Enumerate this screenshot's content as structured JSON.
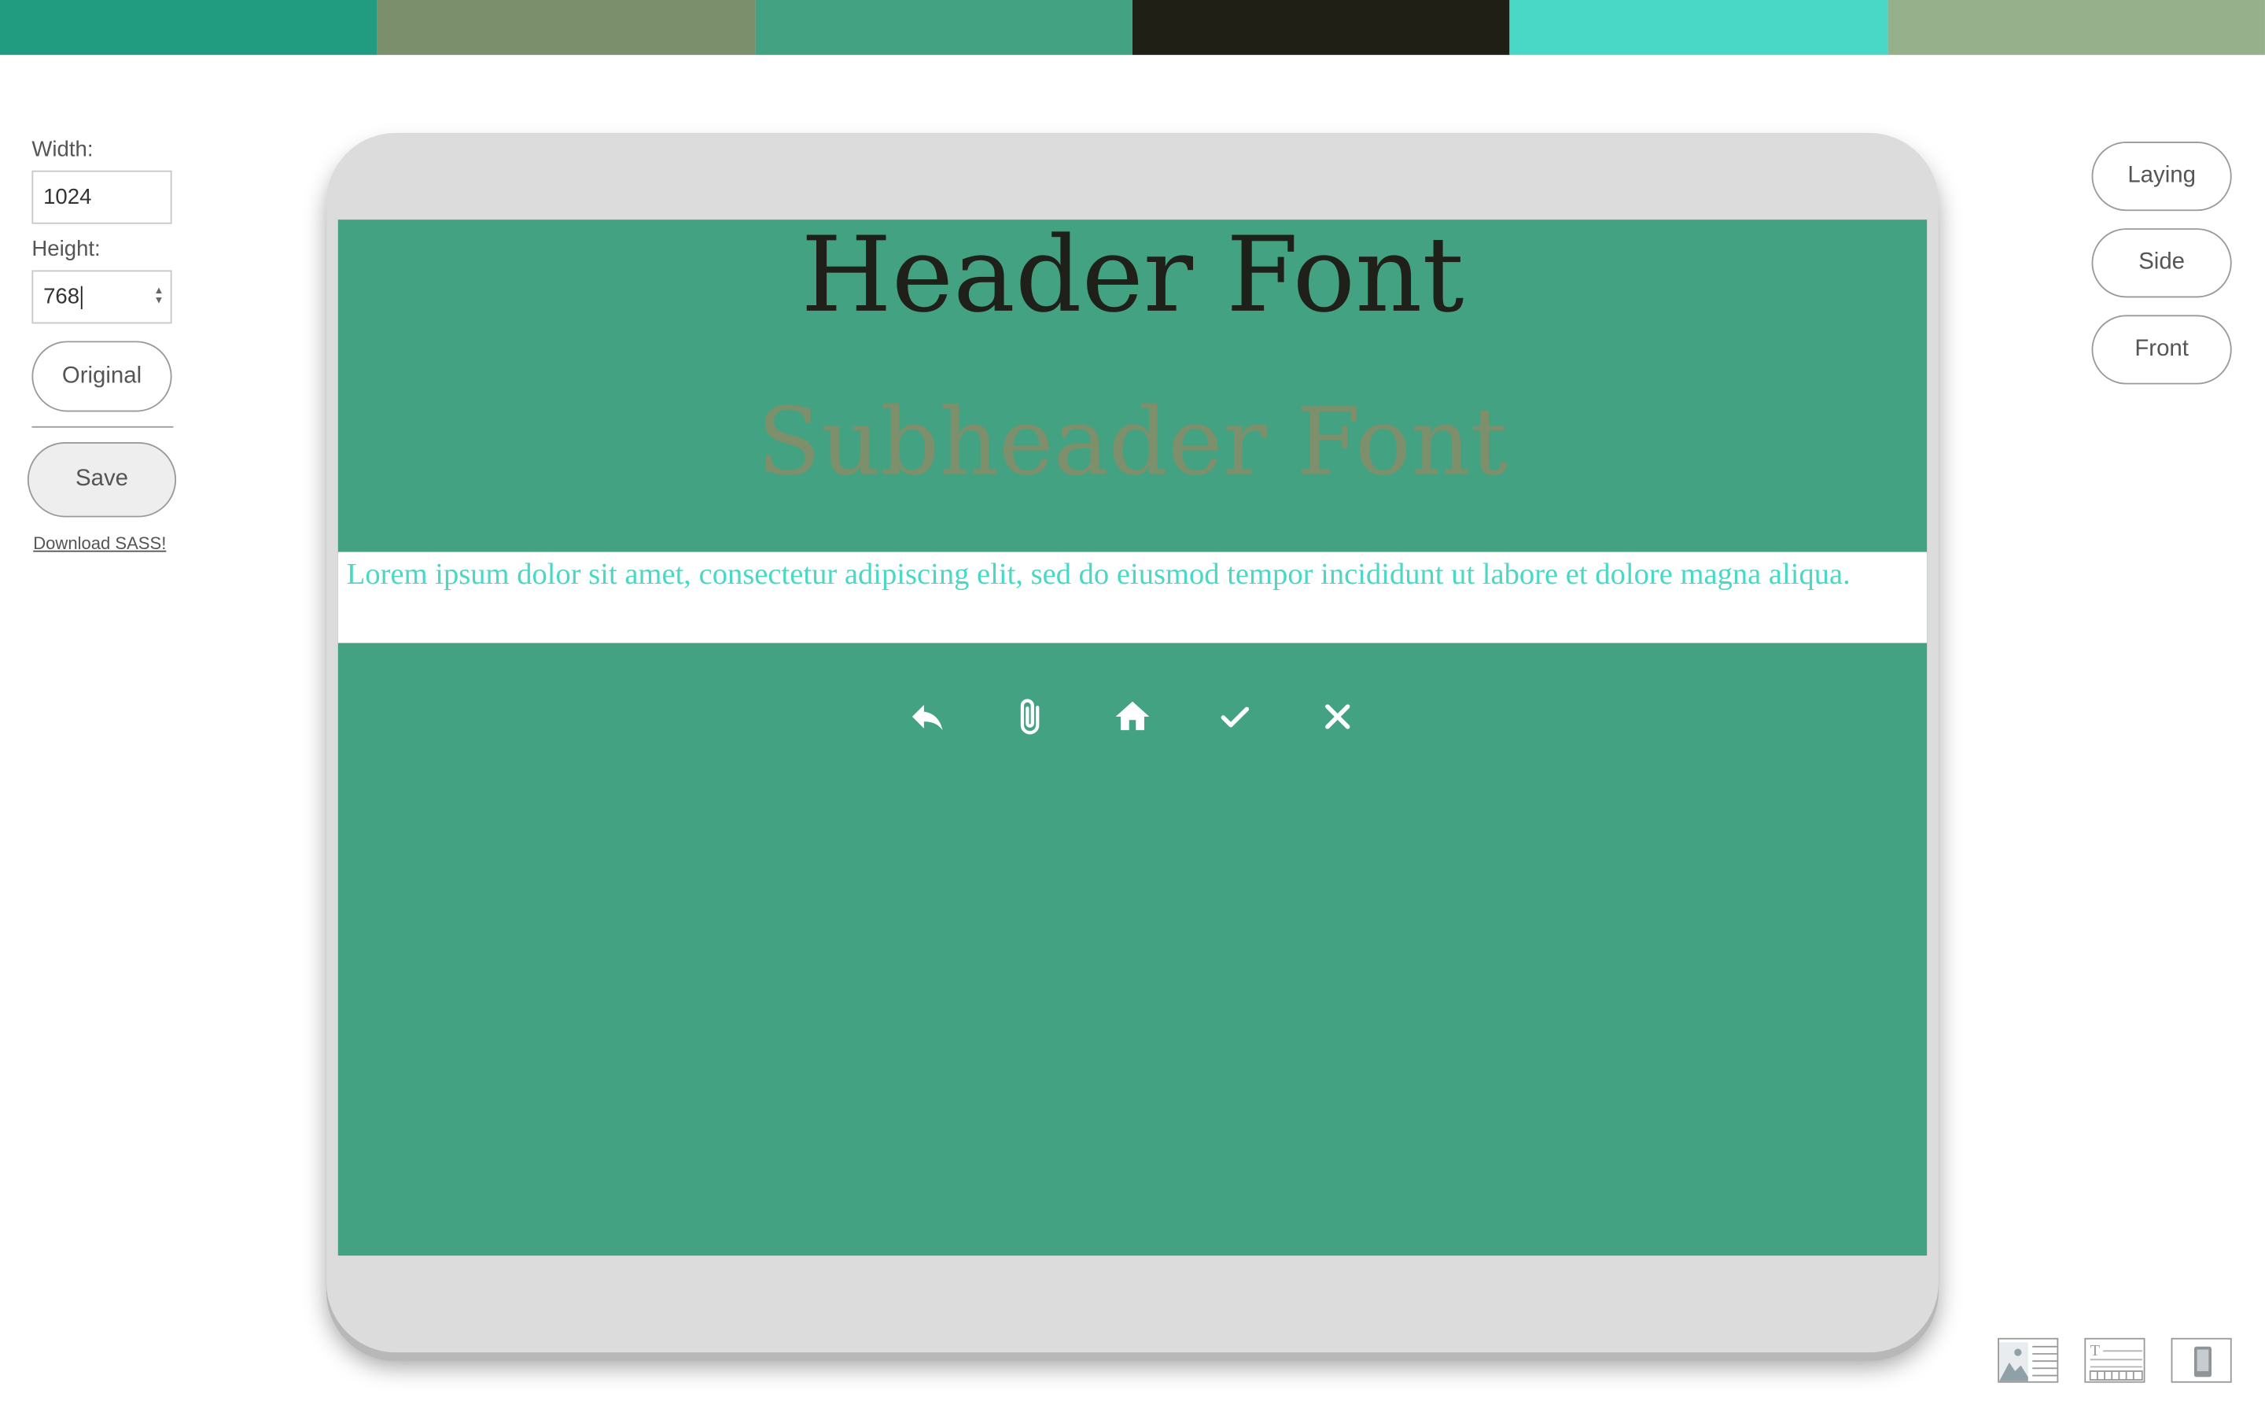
{
  "palette": {
    "colors": [
      "#229c80",
      "#7b8f6c",
      "#43a282",
      "#1f1f16",
      "#4ad8c6",
      "#97b08c"
    ]
  },
  "controls": {
    "width_label": "Width:",
    "width_value": "1024",
    "height_label": "Height:",
    "height_value": "768",
    "original_button": "Original",
    "save_button": "Save",
    "download_link": "Download SASS!"
  },
  "preview": {
    "header": "Header Font",
    "subheader": "Subheader Font",
    "body": "Lorem ipsum dolor sit amet, consectetur adipiscing elit, sed do eiusmod tempor incididunt ut labore et dolore magna aliqua.",
    "icons": [
      "reply-icon",
      "paperclip-icon",
      "home-icon",
      "check-icon",
      "close-icon"
    ],
    "screen_color": "#43a282",
    "header_color": "#20201a",
    "subheader_color": "#7e8f6b",
    "body_color": "#4ad8c6"
  },
  "view_buttons": {
    "laying": "Laying",
    "side": "Side",
    "front": "Front"
  },
  "layout_icons": [
    "image-text-layout-icon",
    "text-grid-layout-icon",
    "phone-layout-icon"
  ]
}
